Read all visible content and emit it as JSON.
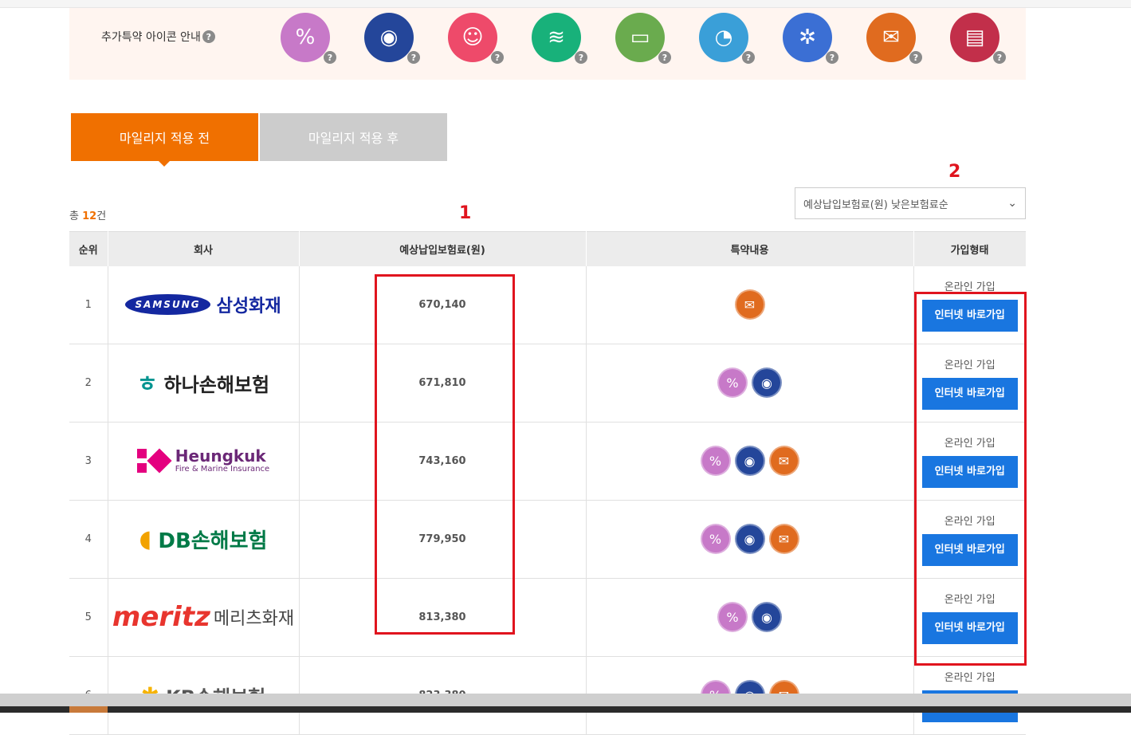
{
  "icon_guide": {
    "label": "추가특약 아이콘 안내",
    "help": "?",
    "icons": [
      {
        "name": "mobile-discount-icon",
        "color": "#c779c8",
        "glyph": "%"
      },
      {
        "name": "blackbox-icon",
        "color": "#24469a",
        "glyph": "◉"
      },
      {
        "name": "child-icon",
        "color": "#ee4a6a",
        "glyph": "☺"
      },
      {
        "name": "connected-car-icon",
        "color": "#18b17a",
        "glyph": "≋"
      },
      {
        "name": "public-transit-icon",
        "color": "#6aab4e",
        "glyph": "▭"
      },
      {
        "name": "safe-driving-score-icon",
        "color": "#3a9fd8",
        "glyph": "◔"
      },
      {
        "name": "tire-icon",
        "color": "#3b6fd4",
        "glyph": "✲"
      },
      {
        "name": "e-document-icon",
        "color": "#e06b1f",
        "glyph": "✉"
      },
      {
        "name": "store-icon",
        "color": "#c22f4a",
        "glyph": "▤"
      }
    ]
  },
  "tabs": [
    {
      "label": "마일리지 적용 전",
      "active": true
    },
    {
      "label": "마일리지 적용 후",
      "active": false
    }
  ],
  "total": {
    "prefix": "총",
    "count": "12",
    "suffix": "건"
  },
  "sort": {
    "selected": "예상납입보험료(원) 낮은보험료순",
    "arrow": "⌄"
  },
  "annotations": {
    "one": "1",
    "two": "2"
  },
  "table": {
    "headers": [
      "순위",
      "회사",
      "예상납입보험료(원)",
      "특약내용",
      "가입형태"
    ],
    "rows": [
      {
        "rank": "1",
        "company": "삼성화재",
        "logo_mark": "SAMSUNG",
        "premium": "670,140",
        "icons": [
          "e-document-icon"
        ],
        "signup": "온라인 가입",
        "button": "인터넷 바로가입"
      },
      {
        "rank": "2",
        "company": "하나손해보험",
        "logo_mark": "ㅎ",
        "premium": "671,810",
        "icons": [
          "mobile-discount-icon",
          "blackbox-icon"
        ],
        "signup": "온라인 가입",
        "button": "인터넷 바로가입"
      },
      {
        "rank": "3",
        "company": "Heungkuk",
        "logo_sub": "Fire & Marine Insurance",
        "premium": "743,160",
        "icons": [
          "mobile-discount-icon",
          "blackbox-icon",
          "e-document-icon"
        ],
        "signup": "온라인 가입",
        "button": "인터넷 바로가입"
      },
      {
        "rank": "4",
        "company": "DB손해보험",
        "logo_mark": "◖",
        "premium": "779,950",
        "icons": [
          "mobile-discount-icon",
          "blackbox-icon",
          "e-document-icon"
        ],
        "signup": "온라인 가입",
        "button": "인터넷 바로가입"
      },
      {
        "rank": "5",
        "company": "메리츠화재",
        "logo_mark": "meritz",
        "premium": "813,380",
        "icons": [
          "mobile-discount-icon",
          "blackbox-icon"
        ],
        "signup": "온라인 가입",
        "button": "인터넷 바로가입"
      },
      {
        "rank": "6",
        "company": "KB손해보험",
        "logo_mark": "✱",
        "premium": "823,380",
        "icons": [
          "mobile-discount-icon",
          "blackbox-icon",
          "e-document-icon"
        ],
        "signup": "온라인 가입",
        "button": "인터넷 바로가입"
      }
    ]
  },
  "colors": {
    "accent": "#f07000",
    "button": "#1976e0",
    "annotation": "#e0141e"
  }
}
